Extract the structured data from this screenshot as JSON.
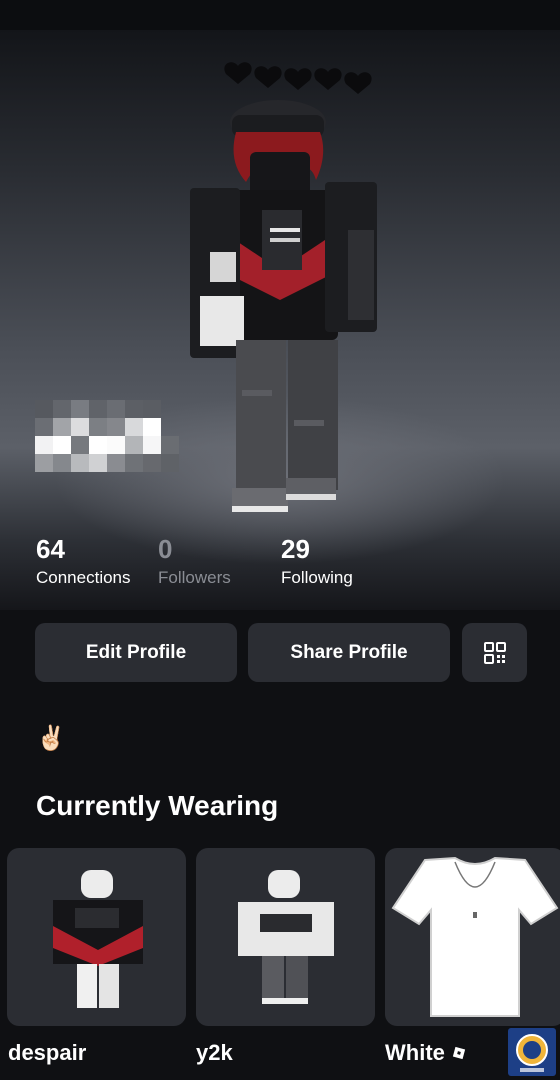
{
  "stats": [
    {
      "value": "64",
      "label": "Connections"
    },
    {
      "value": "0",
      "label": "Followers"
    },
    {
      "value": "29",
      "label": "Following"
    }
  ],
  "buttons": {
    "edit_profile": "Edit Profile",
    "share_profile": "Share Profile",
    "qr_icon": "qr-code-icon"
  },
  "bio": "✌🏻",
  "section_title": "Currently Wearing",
  "wearing": [
    {
      "name": "despair"
    },
    {
      "name": "y2k"
    },
    {
      "name": "White"
    }
  ],
  "colors": {
    "background": "#0f1013",
    "button": "#2b2d33",
    "accent_red": "#b0202b",
    "muted_text": "#8a8d94"
  }
}
